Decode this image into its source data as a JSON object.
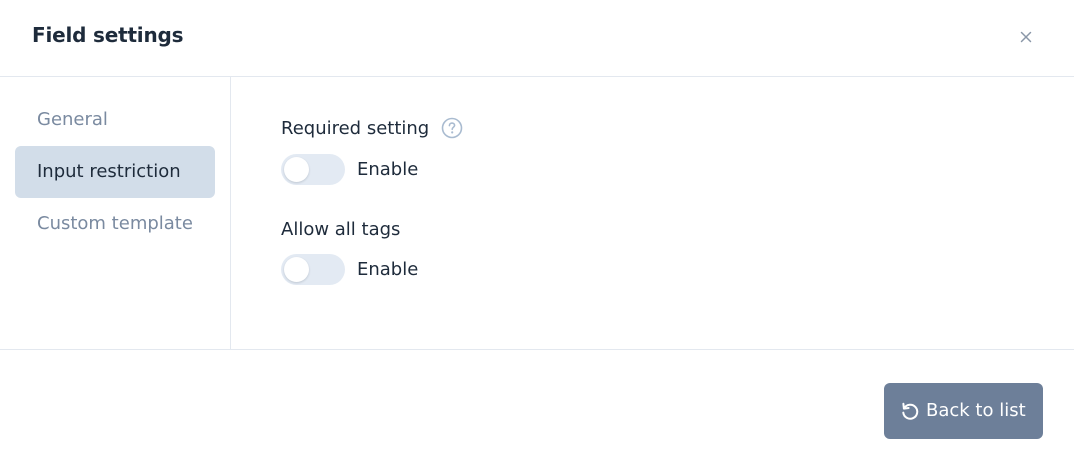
{
  "dialog": {
    "title": "Field settings"
  },
  "sidebar": {
    "items": [
      {
        "label": "General",
        "active": false
      },
      {
        "label": "Input restriction",
        "active": true
      },
      {
        "label": "Custom template",
        "active": false
      }
    ]
  },
  "settings": [
    {
      "label": "Required setting",
      "has_help": true,
      "toggle_label": "Enable",
      "enabled": false
    },
    {
      "label": "Allow all tags",
      "has_help": false,
      "toggle_label": "Enable",
      "enabled": false
    }
  ],
  "footer": {
    "back_label": "Back to list"
  },
  "icons": {
    "close": "close-icon",
    "help": "question-circle-icon",
    "back": "rotate-ccw-icon"
  },
  "colors": {
    "active_nav_bg": "#d2dde9",
    "button_bg": "#6d7f99",
    "toggle_off": "#e3eaf3",
    "muted_text": "#7a8aa0",
    "text": "#1e2b3b"
  }
}
